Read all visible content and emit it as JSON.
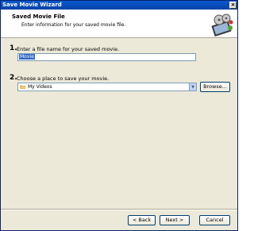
{
  "window": {
    "title": "Save Movie Wizard"
  },
  "header": {
    "title": "Saved Movie File",
    "subtitle": "Enter information for your saved movie file."
  },
  "steps": [
    {
      "number": "1.",
      "label": "Enter a file name for your saved movie."
    },
    {
      "number": "2.",
      "label": "Choose a place to save your movie."
    }
  ],
  "filename": {
    "value": "Movie"
  },
  "location": {
    "value": "My Videos"
  },
  "buttons": {
    "browse": "Browse...",
    "back": "< Back",
    "next": "Next >",
    "cancel": "Cancel"
  },
  "colors": {
    "title_bar": "#0a58cf",
    "dialog_bg": "#ece9d8",
    "selection": "#316ac5"
  },
  "icons": {
    "close": "close-icon",
    "header": "film-reel-icon",
    "folder": "folder-icon",
    "dropdown": "chevron-down-icon"
  }
}
